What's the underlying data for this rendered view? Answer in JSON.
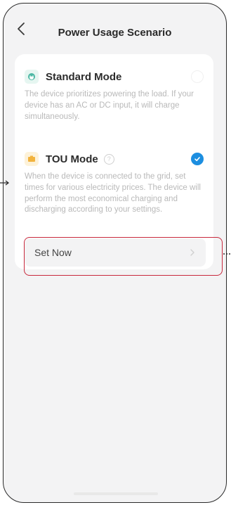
{
  "header": {
    "title": "Power Usage Scenario"
  },
  "modes": [
    {
      "title": "Standard Mode",
      "description": "The device prioritizes powering the load. If your device has an AC or DC input, it will charge simultaneously.",
      "selected": false,
      "icon": "plug-icon"
    },
    {
      "title": "TOU Mode",
      "help_symbol": "?",
      "description": "When the device is connected to the grid, set times for various electricity prices. The device will perform the most economical charging and discharging according to your settings.",
      "selected": true,
      "icon": "battery-icon"
    }
  ],
  "set_now_label": "Set Now",
  "colors": {
    "accent": "#1c8ee0",
    "highlight": "#c8283c",
    "standard_icon": "#4cb8a4",
    "tou_icon": "#f2b33d"
  }
}
